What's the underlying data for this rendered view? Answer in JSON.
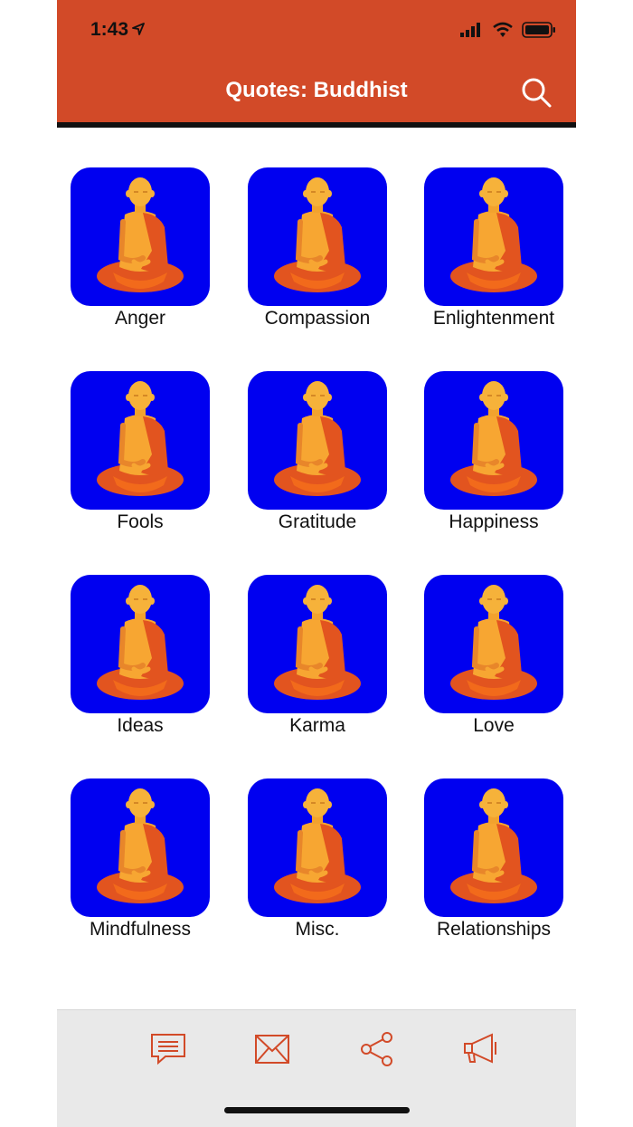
{
  "colors": {
    "accent": "#d24a28",
    "tile": "#0000f0",
    "icon": "#d24a28"
  },
  "status": {
    "time": "1:43"
  },
  "header": {
    "title": "Quotes: Buddhist",
    "search_icon": "search-icon"
  },
  "categories": [
    {
      "label": "Anger"
    },
    {
      "label": "Compassion"
    },
    {
      "label": "Enlightenment"
    },
    {
      "label": "Fools"
    },
    {
      "label": "Gratitude"
    },
    {
      "label": "Happiness"
    },
    {
      "label": "Ideas"
    },
    {
      "label": "Karma"
    },
    {
      "label": "Love"
    },
    {
      "label": "Mindfulness"
    },
    {
      "label": "Misc."
    },
    {
      "label": "Relationships"
    }
  ],
  "toolbar": {
    "icons": [
      "message-icon",
      "mail-icon",
      "share-icon",
      "megaphone-icon"
    ]
  }
}
